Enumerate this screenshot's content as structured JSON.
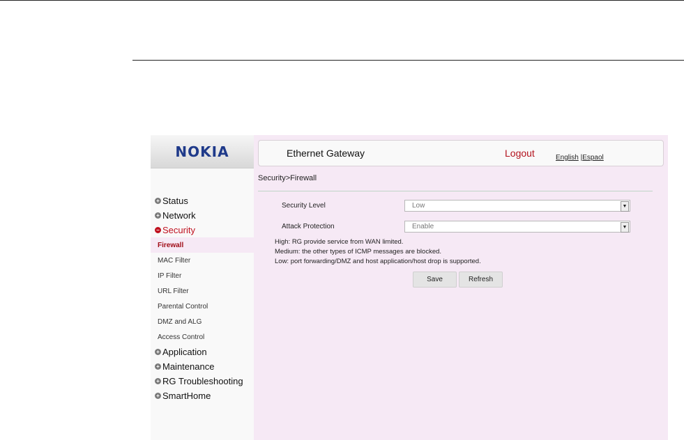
{
  "brand": {
    "logo": "NOKIA"
  },
  "header": {
    "title": "Ethernet Gateway",
    "logout": "Logout",
    "lang_english": "English",
    "lang_separator": "|",
    "lang_espanol": "Espaol"
  },
  "breadcrumb": "Security>Firewall",
  "nav": {
    "status": "Status",
    "network": "Network",
    "security": "Security",
    "security_items": [
      "Firewall",
      "MAC Filter",
      "IP Filter",
      "URL Filter",
      "Parental Control",
      "DMZ and ALG",
      "Access Control"
    ],
    "application": "Application",
    "maintenance": "Maintenance",
    "rg_troubleshooting": "RG Troubleshooting",
    "smarthome": "SmartHome"
  },
  "form": {
    "security_level_label": "Security Level",
    "security_level_value": "Low",
    "attack_protection_label": "Attack Protection",
    "attack_protection_value": "Enable"
  },
  "notes": [
    "High: RG provide service from WAN limited.",
    "Medium: the other types of ICMP messages are blocked.",
    "Low: port forwarding/DMZ and host application/host drop is supported."
  ],
  "buttons": {
    "save": "Save",
    "refresh": "Refresh"
  },
  "icons": {
    "expand": "plus-icon",
    "collapse": "minus-icon",
    "dropdown": "chevron-down-icon"
  },
  "colors": {
    "accent": "#c0111f",
    "panel": "#f6e9f5",
    "logo": "#1f3a8a"
  }
}
